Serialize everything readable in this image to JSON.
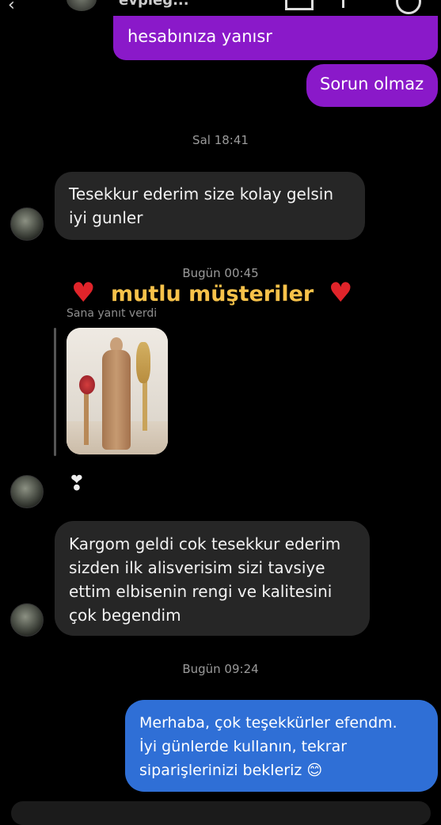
{
  "header": {
    "back_icon": "chevron-left-icon",
    "contact_name": "evpieg...",
    "video_icon": "video-call-icon",
    "flag_icon": "flag-icon",
    "info_icon": "info-icon"
  },
  "messages": {
    "out1": "hesabınıza yanısr",
    "out2": "Sorun olmaz",
    "time1": "Sal 18:41",
    "in1_line1": "Tesekkur ederim size kolay gelsin",
    "in1_line2": "iyi gunler",
    "time2": "Bugün 00:45",
    "story_title": "mutlu müşteriler",
    "reply_label": "Sana yanıt verdi",
    "sticker": "heart-sticker",
    "in2_line1": "Kargom geldi cok tesekkur ederim",
    "in2_line2": "sizden ilk alisverisim sizi tavsiye",
    "in2_line3": "ettim elbisenin rengi ve kalitesini",
    "in2_line4": "çok begendim",
    "time3": "Bugün 09:24",
    "out3_line1": "Merhaba, çok teşekkürler efendm.",
    "out3_line2": "İyi günlerde kullanın, tekrar",
    "out3_line3": "siparişlerinizi bekleriz 😊"
  },
  "colors": {
    "outgoing_purple": "#8a19c9",
    "outgoing_blue": "#2f6fd6",
    "incoming_gray": "#262626",
    "story_title": "#f7c24a",
    "heart": "#e0242a"
  }
}
